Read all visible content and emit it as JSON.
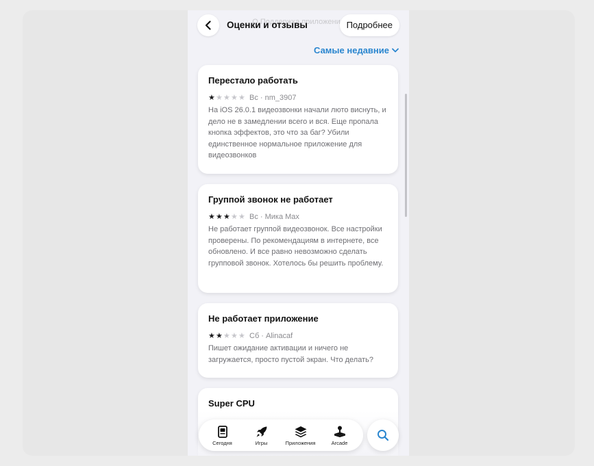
{
  "header": {
    "ghost_title": "О Поддержка приложения",
    "title": "Оценки и отзывы",
    "more_label": "Подробнее"
  },
  "sort": {
    "label": "Самые недавние"
  },
  "reviews": [
    {
      "title": "Перестало работать",
      "rating": 1,
      "meta": "Вс · nm_3907",
      "text": "На iOS 26.0.1 видеозвонки начали люто виснуть, и дело не в замедлении всего и вся. Еще пропала кнопка эффектов, это что за баг? Убили единственное нормальное приложение для видеозвонков"
    },
    {
      "title": "Группой звонок не работает",
      "rating": 3,
      "meta": "Вс · Мика Max",
      "text": "Не работает группой видеозвонок. Все настройки проверены. По рекомендациям в интернете, все обновлено. И все равно невозможно сделать групповой звонок. Хотелось бы решить проблему."
    },
    {
      "title": "Не работает приложение",
      "rating": 2,
      "meta": "Сб · Alinacaf",
      "text": "Пишет ожидание активации и ничего не загружается, просто пустой экран. Что делать?"
    },
    {
      "title": "Super CPU",
      "rating": null,
      "meta": "",
      "text": ""
    }
  ],
  "tabbar": {
    "items": [
      {
        "label": "Сегодня",
        "icon": "today-icon"
      },
      {
        "label": "Игры",
        "icon": "rocket-icon"
      },
      {
        "label": "Приложения",
        "icon": "apps-stack-icon"
      },
      {
        "label": "Arcade",
        "icon": "joystick-icon"
      }
    ],
    "search_icon": "search-icon"
  },
  "colors": {
    "accent": "#2a86cf",
    "star_on": "#1c1c1e",
    "star_off": "#c7c7cc",
    "background": "#f2f2f7"
  }
}
